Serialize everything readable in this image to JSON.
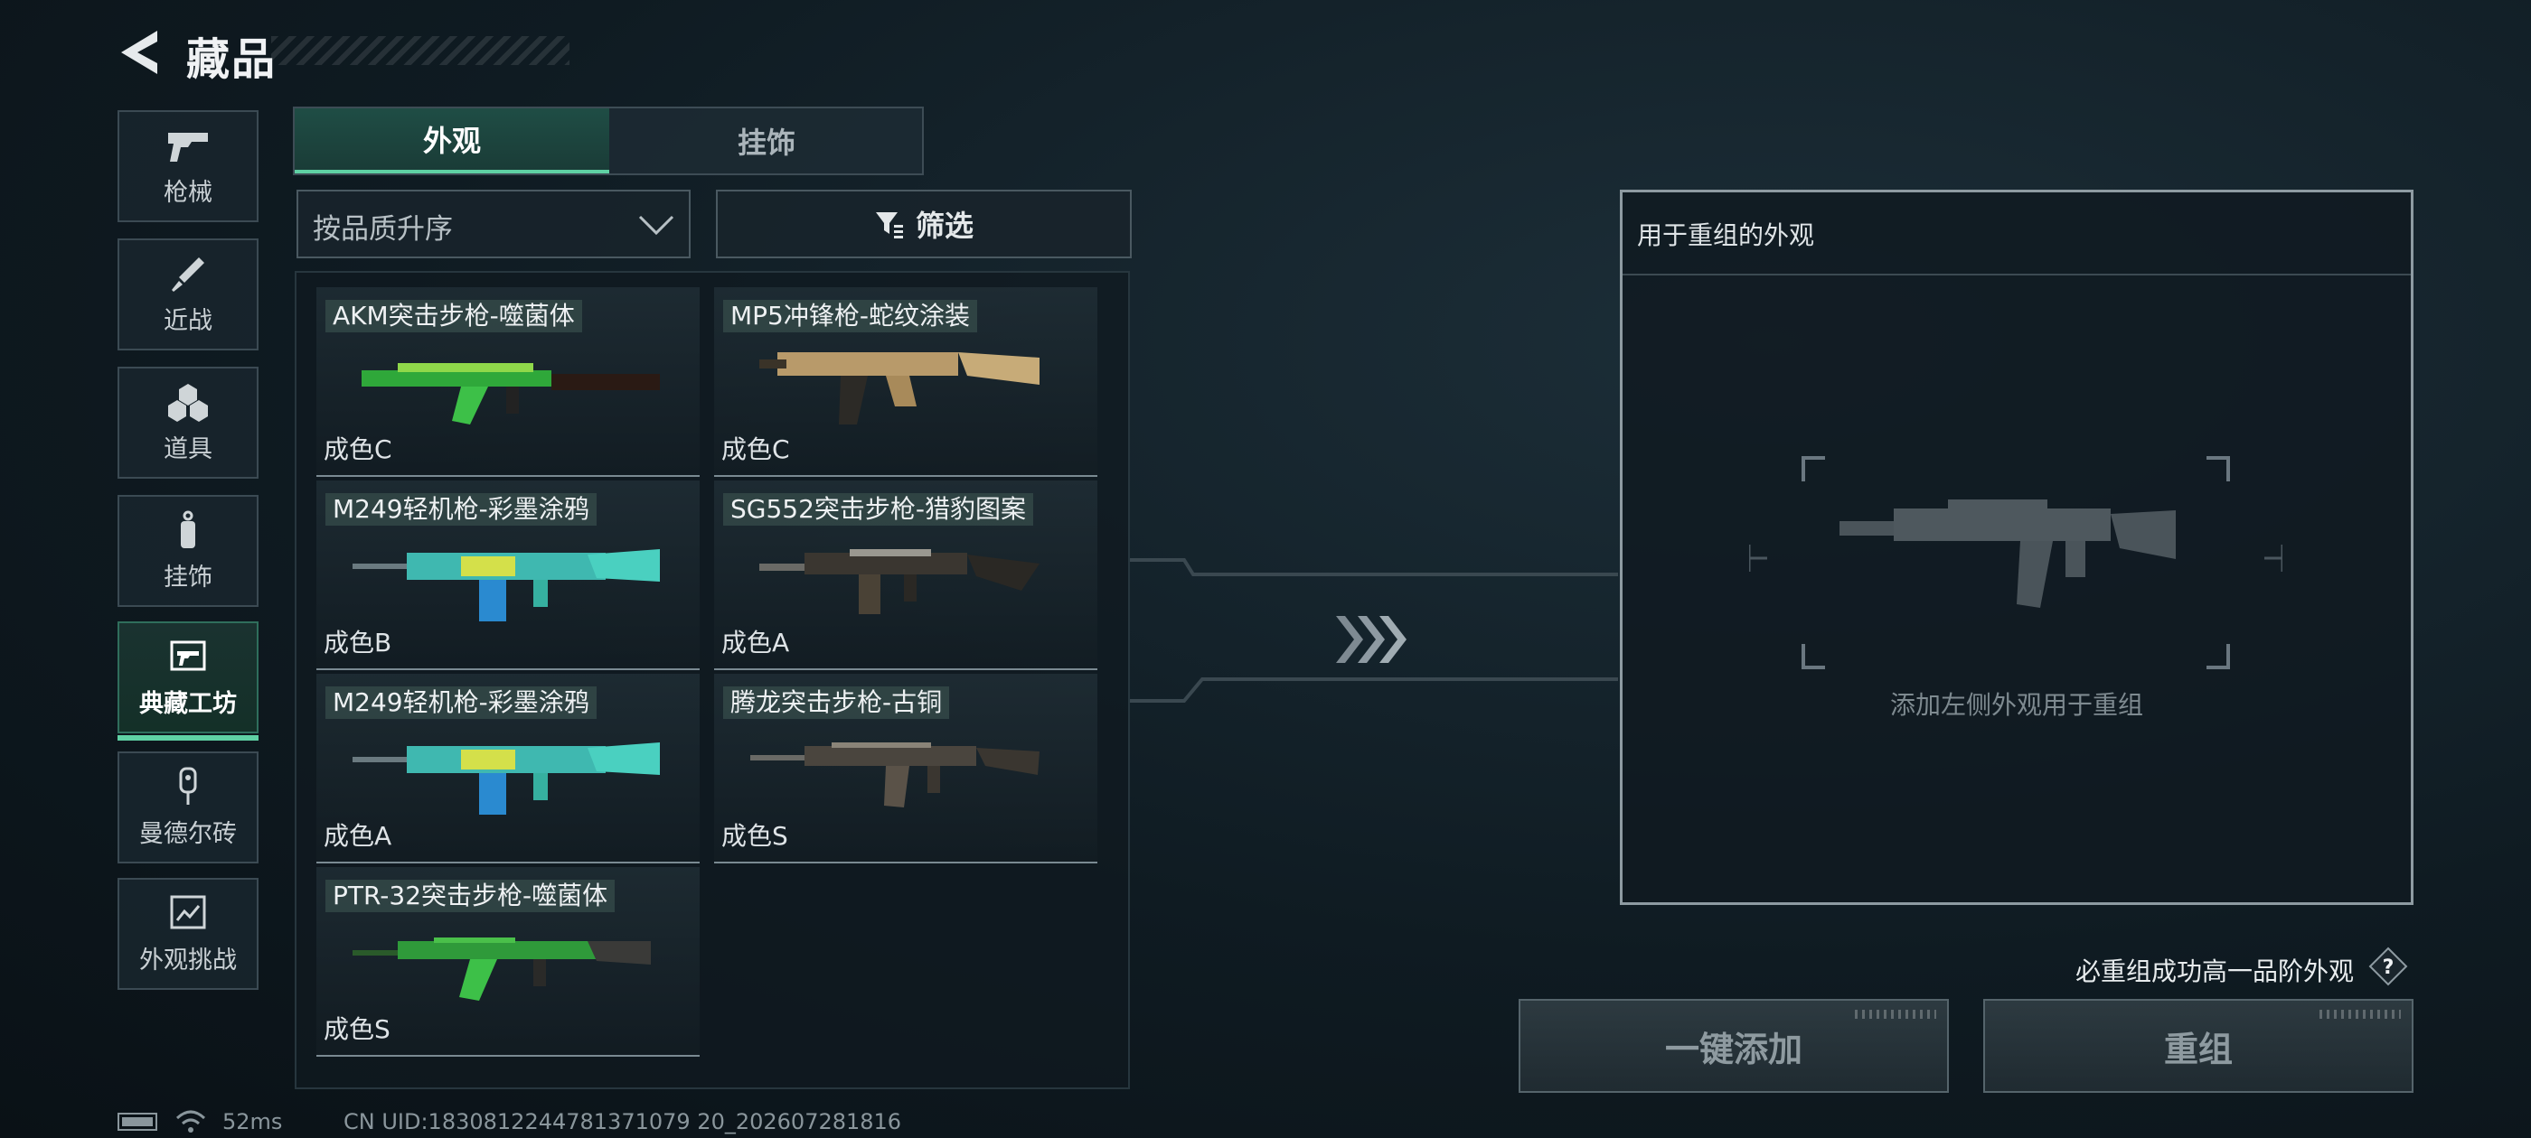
{
  "header": {
    "title": "藏品",
    "back_icon": "back-arrow-icon"
  },
  "sidebar": {
    "items": [
      {
        "label": "枪械",
        "icon": "pistol-icon",
        "active": false
      },
      {
        "label": "近战",
        "icon": "knife-icon",
        "active": false
      },
      {
        "label": "道具",
        "icon": "grenades-icon",
        "active": false
      },
      {
        "label": "挂饰",
        "icon": "charm-icon",
        "active": false
      },
      {
        "label": "典藏工坊",
        "icon": "workshop-icon",
        "active": true
      },
      {
        "label": "曼德尔砖",
        "icon": "brick-icon",
        "active": false
      },
      {
        "label": "外观挑战",
        "icon": "challenge-icon",
        "active": false
      }
    ]
  },
  "tabs": [
    {
      "label": "外观",
      "active": true
    },
    {
      "label": "挂饰",
      "active": false
    }
  ],
  "sort": {
    "label": "按品质升序"
  },
  "filter": {
    "label": "筛选"
  },
  "items": [
    {
      "name": "AKM突击步枪-噬菌体",
      "grade": "成色C"
    },
    {
      "name": "MP5冲锋枪-蛇纹涂装",
      "grade": "成色C"
    },
    {
      "name": "M249轻机枪-彩墨涂鸦",
      "grade": "成色B"
    },
    {
      "name": "SG552突击步枪-猎豹图案",
      "grade": "成色A"
    },
    {
      "name": "M249轻机枪-彩墨涂鸦",
      "grade": "成色A"
    },
    {
      "name": "腾龙突击步枪-古铜",
      "grade": "成色S"
    },
    {
      "name": "PTR-32突击步枪-噬菌体",
      "grade": "成色S"
    }
  ],
  "recombine_panel": {
    "title": "用于重组的外观",
    "placeholder": "添加左侧外观用于重组"
  },
  "hint": "必重组成功高一品阶外观",
  "buttons": {
    "add_all": "一键添加",
    "recombine": "重组"
  },
  "status": {
    "ping": "52ms",
    "uid": "CN UID:1830812244781371079 20_202607281816"
  },
  "colors": {
    "accent": "#5fd1a4",
    "panel_border": "#8e9ba2"
  }
}
